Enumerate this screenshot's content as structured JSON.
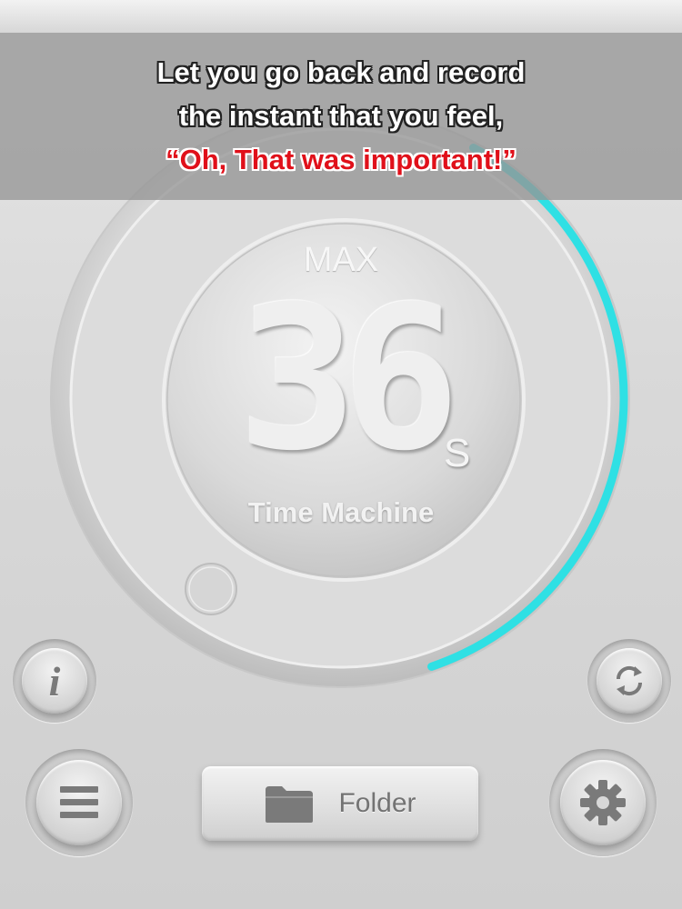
{
  "banner": {
    "line1": "Let you go back and record",
    "line2": "the instant that you feel,",
    "line3": "“Oh, That was important!”"
  },
  "timer": {
    "max_label": "MAX",
    "seconds_value": "36",
    "seconds_unit": "S",
    "app_name": "Time Machine",
    "progress_fraction": 0.37
  },
  "controls": {
    "info_icon": "info-icon",
    "sync_icon": "sync-icon",
    "menu_icon": "menu-icon",
    "settings_icon": "gear-icon",
    "folder_icon": "folder-icon",
    "folder_label": "Folder"
  },
  "colors": {
    "accent": "#2fe0e4",
    "highlight_red": "#e0101a"
  }
}
